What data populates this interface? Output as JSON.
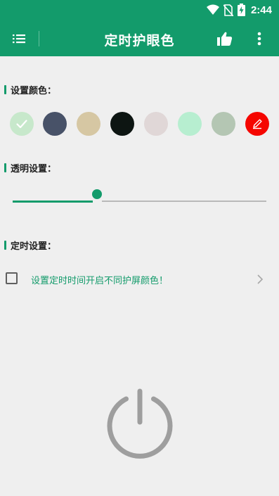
{
  "status_bar": {
    "time": "2:44",
    "icons": [
      "wifi-icon",
      "no-sim-icon",
      "battery-charging-icon"
    ]
  },
  "app_bar": {
    "title": "定时护眼色",
    "icons": [
      "menu-list-icon",
      "thumbs-up-icon",
      "more-vert-icon"
    ]
  },
  "colors": {
    "accent": "#139b6b"
  },
  "color_section": {
    "title": "设置颜色：",
    "swatches": [
      {
        "name": "swatch-light-green",
        "color": "#c7e8cb",
        "selected": true
      },
      {
        "name": "swatch-slate-blue",
        "color": "#485268",
        "selected": false
      },
      {
        "name": "swatch-beige",
        "color": "#d6c7a3",
        "selected": false
      },
      {
        "name": "swatch-black",
        "color": "#0d1512",
        "selected": false
      },
      {
        "name": "swatch-pale-pink",
        "color": "#e0d7d7",
        "selected": false
      },
      {
        "name": "swatch-mint",
        "color": "#b7eed0",
        "selected": false
      },
      {
        "name": "swatch-gray-green",
        "color": "#b4c6b3",
        "selected": false
      },
      {
        "name": "swatch-custom-red",
        "color": "#f50600",
        "selected": false,
        "icon": "edit-pencil-icon"
      }
    ]
  },
  "transparency_section": {
    "title": "透明设置：",
    "slider_value_fraction": 0.33
  },
  "timer_section": {
    "title": "定时设置：",
    "checkbox_checked": false,
    "row_text": "设置定时时间开启不同护屏颜色！"
  },
  "power_button": {
    "icon": "power-icon",
    "state": "off"
  }
}
